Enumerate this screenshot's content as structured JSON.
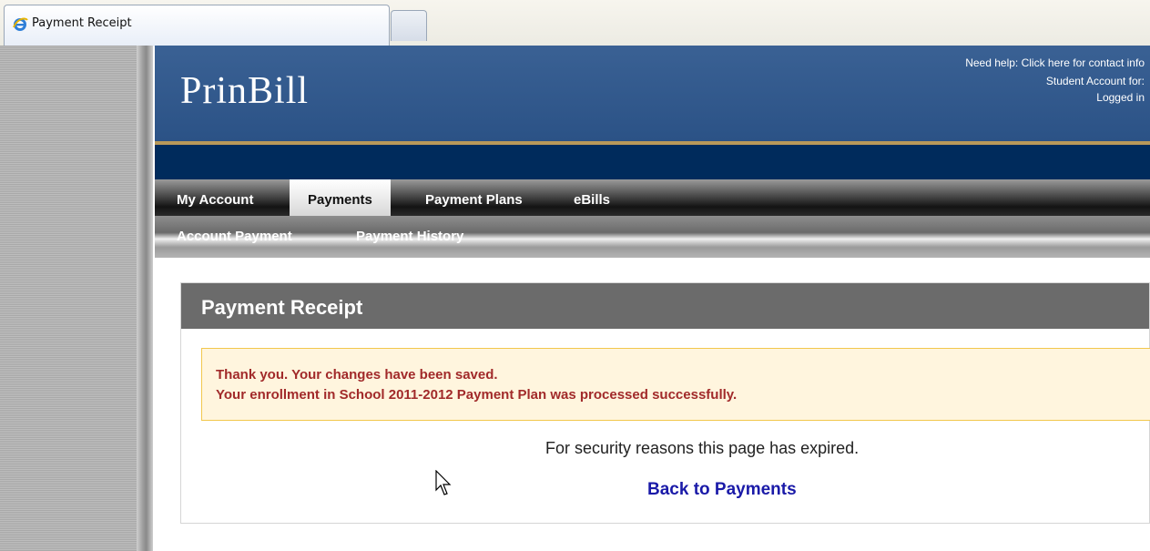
{
  "browser": {
    "tab_title": "Payment Receipt",
    "tab_icon": "ie-icon",
    "new_tab_icon": "new-tab-icon"
  },
  "header": {
    "logo": "PrinBill",
    "help_text": "Need help: Click here for contact info",
    "account_text": "Student Account for:",
    "login_text": "Logged in"
  },
  "nav": {
    "primary": [
      {
        "label": "My Account",
        "active": false
      },
      {
        "label": "Payments",
        "active": true
      },
      {
        "label": "Payment Plans",
        "active": false
      },
      {
        "label": "eBills",
        "active": false
      }
    ],
    "secondary": [
      {
        "label": "Account Payment"
      },
      {
        "label": "Payment History"
      }
    ]
  },
  "receipt": {
    "title": "Payment Receipt",
    "message_line1": "Thank you. Your changes have been saved.",
    "message_line2": "Your enrollment in School 2011-2012 Payment Plan was processed successfully.",
    "expired_text": "For security reasons this page has expired.",
    "back_link": "Back to Payments"
  },
  "colors": {
    "header_blue": "#2f5a8e",
    "gold_rule": "#b8995a",
    "navy_band": "#002b5c",
    "message_text": "#a12a2a",
    "message_bg": "#fff5de",
    "link": "#1a1aa8"
  }
}
